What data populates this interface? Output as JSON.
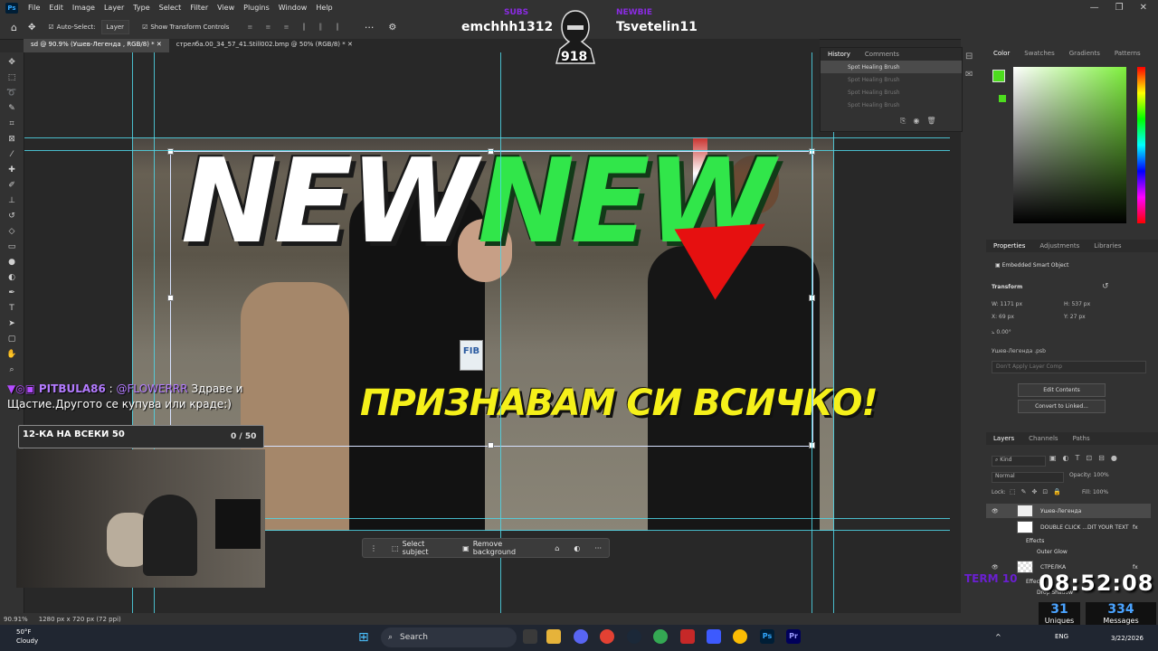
{
  "menubar": {
    "items": [
      "File",
      "Edit",
      "Image",
      "Layer",
      "Type",
      "Select",
      "Filter",
      "View",
      "Plugins",
      "Window",
      "Help"
    ]
  },
  "options": {
    "auto_select": "Auto-Select:",
    "auto_select_target": "Layer",
    "show_transform": "Show Transform Controls"
  },
  "tabs": [
    {
      "label": "sd @ 90.9% (Ушев-Легенда , RGB/8) *"
    },
    {
      "label": "стрелба.00_34_57_41.Still002.bmp @ 50% (RGB/8) *"
    }
  ],
  "stream": {
    "left_label": "SUBS",
    "left_name": "emchhh1312",
    "right_label": "NEWBIE",
    "right_name": "Tsvetelin11",
    "badge_number": "918"
  },
  "thumbnail": {
    "headline_white": "NEW",
    "headline_green": "NEW",
    "subtitle": "ПРИЗНАВАМ СИ ВСИЧКО!",
    "badge_text": "FIB"
  },
  "chat": {
    "user": "PITBULA86",
    "mention": "@FLOWERRR",
    "message_1": "Здраве и",
    "message_2": "Щастие.Другото се купува или краде:)",
    "goal_label": "12-КА НА ВСЕКИ 50",
    "goal_value": "0 / 50"
  },
  "context_bar": {
    "select_subject": "Select subject",
    "remove_background": "Remove background"
  },
  "status": {
    "zoom": "90.91%",
    "doc_info": "1280 px x 720 px (72 ppi)"
  },
  "history": {
    "tabs": [
      "History",
      "Comments"
    ],
    "items": [
      {
        "label": "Spot Healing Brush",
        "state": "active"
      },
      {
        "label": "Spot Healing Brush",
        "state": "dim"
      },
      {
        "label": "Spot Healing Brush",
        "state": "dim"
      },
      {
        "label": "Spot Healing Brush",
        "state": "dim"
      }
    ]
  },
  "color_panel": {
    "tabs": [
      "Color",
      "Swatches",
      "Gradients",
      "Patterns"
    ],
    "foreground": "#4ddc1e"
  },
  "properties": {
    "tabs": [
      "Properties",
      "Adjustments",
      "Libraries"
    ],
    "type": "Embedded Smart Object",
    "transform_title": "Transform",
    "w": "W:  1171 px",
    "h": "H:  537 px",
    "x": "X:  69 px",
    "y": "Y:  27 px",
    "angle": "0.00°",
    "filename": "Ушев-Легенда .psb",
    "layer_comp": "Don't Apply Layer Comp",
    "edit_contents": "Edit Contents",
    "convert_linked": "Convert to Linked..."
  },
  "layers": {
    "tabs": [
      "Layers",
      "Channels",
      "Paths"
    ],
    "kind": "Kind",
    "blend": "Normal",
    "opacity": "Opacity:  100%",
    "lock": "Lock:",
    "fill": "Fill:  100%",
    "rows": [
      {
        "name": "Ушев-Легенда"
      },
      {
        "name": "DOUBLE CLICK ...DIT YOUR TEXT"
      },
      {
        "name": "Effects"
      },
      {
        "name": "Outer Glow"
      },
      {
        "name": "СТРЕЛКА"
      },
      {
        "name": "Effects"
      },
      {
        "name": "Drop Shadow"
      }
    ]
  },
  "overlay": {
    "timer_label": "TERM 10",
    "timer": "08:52:08",
    "uniques": "31",
    "uniques_label": "Uniques",
    "messages": "334",
    "messages_label": "Messages"
  },
  "taskbar": {
    "weather_temp": "50°F",
    "weather_desc": "Cloudy",
    "search": "Search",
    "lang": "ENG",
    "date": "3/22/2026"
  }
}
